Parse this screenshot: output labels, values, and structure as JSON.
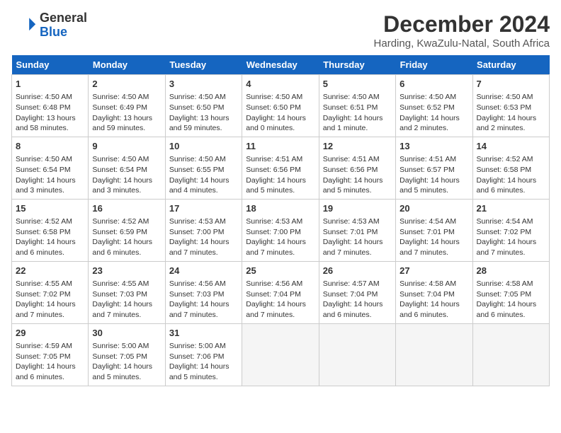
{
  "header": {
    "logo_general": "General",
    "logo_blue": "Blue",
    "title": "December 2024",
    "location": "Harding, KwaZulu-Natal, South Africa"
  },
  "calendar": {
    "days_of_week": [
      "Sunday",
      "Monday",
      "Tuesday",
      "Wednesday",
      "Thursday",
      "Friday",
      "Saturday"
    ],
    "weeks": [
      [
        {
          "day": "1",
          "sunrise": "Sunrise: 4:50 AM",
          "sunset": "Sunset: 6:48 PM",
          "daylight": "Daylight: 13 hours and 58 minutes."
        },
        {
          "day": "2",
          "sunrise": "Sunrise: 4:50 AM",
          "sunset": "Sunset: 6:49 PM",
          "daylight": "Daylight: 13 hours and 59 minutes."
        },
        {
          "day": "3",
          "sunrise": "Sunrise: 4:50 AM",
          "sunset": "Sunset: 6:50 PM",
          "daylight": "Daylight: 13 hours and 59 minutes."
        },
        {
          "day": "4",
          "sunrise": "Sunrise: 4:50 AM",
          "sunset": "Sunset: 6:50 PM",
          "daylight": "Daylight: 14 hours and 0 minutes."
        },
        {
          "day": "5",
          "sunrise": "Sunrise: 4:50 AM",
          "sunset": "Sunset: 6:51 PM",
          "daylight": "Daylight: 14 hours and 1 minute."
        },
        {
          "day": "6",
          "sunrise": "Sunrise: 4:50 AM",
          "sunset": "Sunset: 6:52 PM",
          "daylight": "Daylight: 14 hours and 2 minutes."
        },
        {
          "day": "7",
          "sunrise": "Sunrise: 4:50 AM",
          "sunset": "Sunset: 6:53 PM",
          "daylight": "Daylight: 14 hours and 2 minutes."
        }
      ],
      [
        {
          "day": "8",
          "sunrise": "Sunrise: 4:50 AM",
          "sunset": "Sunset: 6:54 PM",
          "daylight": "Daylight: 14 hours and 3 minutes."
        },
        {
          "day": "9",
          "sunrise": "Sunrise: 4:50 AM",
          "sunset": "Sunset: 6:54 PM",
          "daylight": "Daylight: 14 hours and 3 minutes."
        },
        {
          "day": "10",
          "sunrise": "Sunrise: 4:50 AM",
          "sunset": "Sunset: 6:55 PM",
          "daylight": "Daylight: 14 hours and 4 minutes."
        },
        {
          "day": "11",
          "sunrise": "Sunrise: 4:51 AM",
          "sunset": "Sunset: 6:56 PM",
          "daylight": "Daylight: 14 hours and 5 minutes."
        },
        {
          "day": "12",
          "sunrise": "Sunrise: 4:51 AM",
          "sunset": "Sunset: 6:56 PM",
          "daylight": "Daylight: 14 hours and 5 minutes."
        },
        {
          "day": "13",
          "sunrise": "Sunrise: 4:51 AM",
          "sunset": "Sunset: 6:57 PM",
          "daylight": "Daylight: 14 hours and 5 minutes."
        },
        {
          "day": "14",
          "sunrise": "Sunrise: 4:52 AM",
          "sunset": "Sunset: 6:58 PM",
          "daylight": "Daylight: 14 hours and 6 minutes."
        }
      ],
      [
        {
          "day": "15",
          "sunrise": "Sunrise: 4:52 AM",
          "sunset": "Sunset: 6:58 PM",
          "daylight": "Daylight: 14 hours and 6 minutes."
        },
        {
          "day": "16",
          "sunrise": "Sunrise: 4:52 AM",
          "sunset": "Sunset: 6:59 PM",
          "daylight": "Daylight: 14 hours and 6 minutes."
        },
        {
          "day": "17",
          "sunrise": "Sunrise: 4:53 AM",
          "sunset": "Sunset: 7:00 PM",
          "daylight": "Daylight: 14 hours and 7 minutes."
        },
        {
          "day": "18",
          "sunrise": "Sunrise: 4:53 AM",
          "sunset": "Sunset: 7:00 PM",
          "daylight": "Daylight: 14 hours and 7 minutes."
        },
        {
          "day": "19",
          "sunrise": "Sunrise: 4:53 AM",
          "sunset": "Sunset: 7:01 PM",
          "daylight": "Daylight: 14 hours and 7 minutes."
        },
        {
          "day": "20",
          "sunrise": "Sunrise: 4:54 AM",
          "sunset": "Sunset: 7:01 PM",
          "daylight": "Daylight: 14 hours and 7 minutes."
        },
        {
          "day": "21",
          "sunrise": "Sunrise: 4:54 AM",
          "sunset": "Sunset: 7:02 PM",
          "daylight": "Daylight: 14 hours and 7 minutes."
        }
      ],
      [
        {
          "day": "22",
          "sunrise": "Sunrise: 4:55 AM",
          "sunset": "Sunset: 7:02 PM",
          "daylight": "Daylight: 14 hours and 7 minutes."
        },
        {
          "day": "23",
          "sunrise": "Sunrise: 4:55 AM",
          "sunset": "Sunset: 7:03 PM",
          "daylight": "Daylight: 14 hours and 7 minutes."
        },
        {
          "day": "24",
          "sunrise": "Sunrise: 4:56 AM",
          "sunset": "Sunset: 7:03 PM",
          "daylight": "Daylight: 14 hours and 7 minutes."
        },
        {
          "day": "25",
          "sunrise": "Sunrise: 4:56 AM",
          "sunset": "Sunset: 7:04 PM",
          "daylight": "Daylight: 14 hours and 7 minutes."
        },
        {
          "day": "26",
          "sunrise": "Sunrise: 4:57 AM",
          "sunset": "Sunset: 7:04 PM",
          "daylight": "Daylight: 14 hours and 6 minutes."
        },
        {
          "day": "27",
          "sunrise": "Sunrise: 4:58 AM",
          "sunset": "Sunset: 7:04 PM",
          "daylight": "Daylight: 14 hours and 6 minutes."
        },
        {
          "day": "28",
          "sunrise": "Sunrise: 4:58 AM",
          "sunset": "Sunset: 7:05 PM",
          "daylight": "Daylight: 14 hours and 6 minutes."
        }
      ],
      [
        {
          "day": "29",
          "sunrise": "Sunrise: 4:59 AM",
          "sunset": "Sunset: 7:05 PM",
          "daylight": "Daylight: 14 hours and 6 minutes."
        },
        {
          "day": "30",
          "sunrise": "Sunrise: 5:00 AM",
          "sunset": "Sunset: 7:05 PM",
          "daylight": "Daylight: 14 hours and 5 minutes."
        },
        {
          "day": "31",
          "sunrise": "Sunrise: 5:00 AM",
          "sunset": "Sunset: 7:06 PM",
          "daylight": "Daylight: 14 hours and 5 minutes."
        },
        null,
        null,
        null,
        null
      ]
    ]
  }
}
